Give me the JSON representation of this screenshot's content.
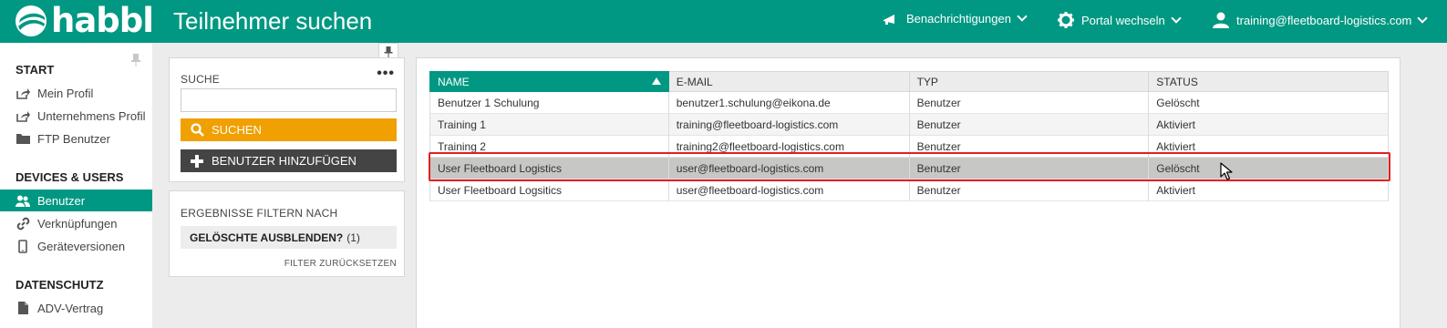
{
  "header": {
    "logo_text": "habbl",
    "page_title": "Teilnehmer suchen",
    "notifications_label": "Benachrichtigungen",
    "portal_label": "Portal wechseln",
    "user_label": "training@fleetboard-logistics.com"
  },
  "sidebar": {
    "sections": [
      {
        "title": "START",
        "items": [
          {
            "label": "Mein Profil",
            "icon": "share-icon"
          },
          {
            "label": "Unternehmens Profil",
            "icon": "share-icon"
          },
          {
            "label": "FTP Benutzer",
            "icon": "folder-icon"
          }
        ]
      },
      {
        "title": "DEVICES & USERS",
        "items": [
          {
            "label": "Benutzer",
            "icon": "users-icon",
            "active": true
          },
          {
            "label": "Verknüpfungen",
            "icon": "link-icon"
          },
          {
            "label": "Geräteversionen",
            "icon": "phone-icon"
          }
        ]
      },
      {
        "title": "DATENSCHUTZ",
        "items": [
          {
            "label": "ADV-Vertrag",
            "icon": "document-icon"
          }
        ]
      }
    ]
  },
  "search": {
    "label": "SUCHE",
    "input_value": "",
    "input_placeholder": "",
    "search_button": "SUCHEN",
    "add_button": "BENUTZER HINZUFÜGEN"
  },
  "filter": {
    "title": "ERGEBNISSE FILTERN NACH",
    "option_label": "GELÖSCHTE AUSBLENDEN?",
    "option_count": "(1)",
    "reset_label": "FILTER ZURÜCKSETZEN"
  },
  "results": {
    "columns": [
      "NAME",
      "E-MAIL",
      "TYP",
      "STATUS"
    ],
    "sorted_column": "NAME",
    "rows": [
      {
        "name": "Benutzer 1 Schulung",
        "email": "benutzer1.schulung@eikona.de",
        "type": "Benutzer",
        "status": "Gelöscht"
      },
      {
        "name": "Training 1",
        "email": "training@fleetboard-logistics.com",
        "type": "Benutzer",
        "status": "Aktiviert"
      },
      {
        "name": "Training 2",
        "email": "training2@fleetboard-logistics.com",
        "type": "Benutzer",
        "status": "Aktiviert"
      },
      {
        "name": "User Fleetboard Logistics",
        "email": "user@fleetboard-logistics.com",
        "type": "Benutzer",
        "status": "Gelöscht",
        "selected": true
      },
      {
        "name": "User Fleetboard Logsitics",
        "email": "user@fleetboard-logistics.com",
        "type": "Benutzer",
        "status": "Aktiviert"
      }
    ]
  },
  "colors": {
    "brand": "#009882",
    "search_button": "#f0a000",
    "add_button": "#444444",
    "highlight": "#e02020"
  }
}
